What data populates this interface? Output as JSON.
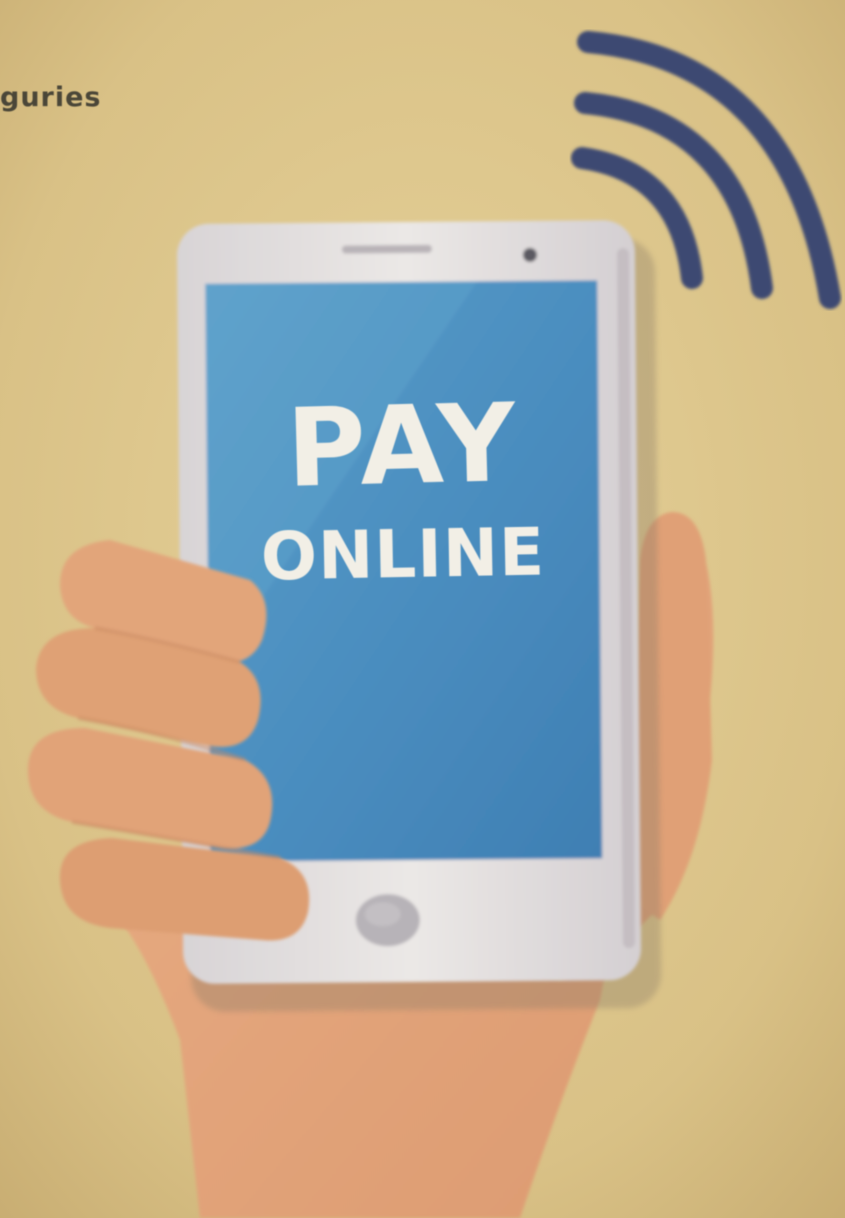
{
  "corner_text": "guries",
  "screen": {
    "line1": "PAY",
    "line2": "ONLINE"
  },
  "icons": {
    "wireless": "wifi-signal-icon",
    "phone": "smartphone-icon",
    "hand": "hand-icon",
    "home_button": "home-button-icon"
  },
  "colors": {
    "background": "#dcc58c",
    "screen": "#4a8dbf",
    "phone_body": "#e6e2df",
    "skin": "#e3a478",
    "signal": "#3e4a72",
    "text": "#f2efe6"
  }
}
